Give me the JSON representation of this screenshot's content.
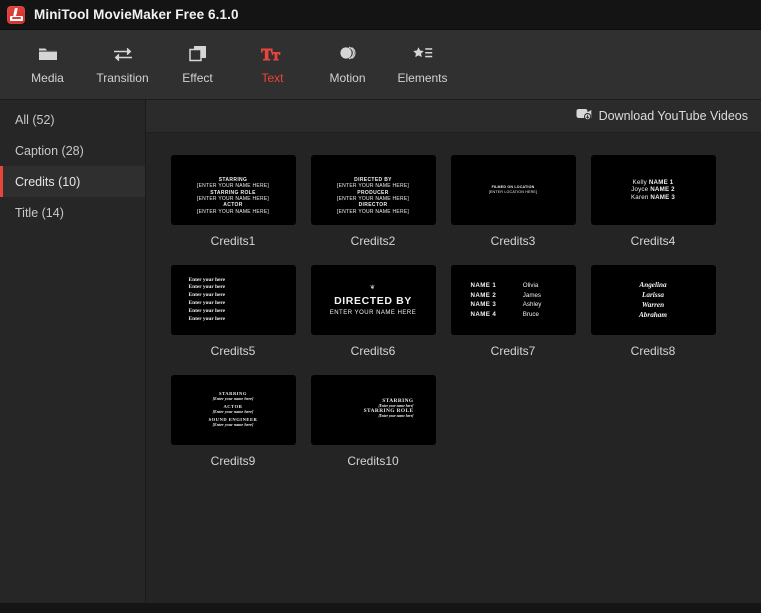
{
  "window": {
    "title": "MiniTool MovieMaker Free 6.1.0",
    "icon": "app-logo-icon"
  },
  "toolbar": {
    "items": [
      {
        "label": "Media",
        "icon": "folder-icon",
        "active": false
      },
      {
        "label": "Transition",
        "icon": "transition-icon",
        "active": false
      },
      {
        "label": "Effect",
        "icon": "layers-icon",
        "active": false
      },
      {
        "label": "Text",
        "icon": "text-icon",
        "active": true
      },
      {
        "label": "Motion",
        "icon": "motion-icon",
        "active": false
      },
      {
        "label": "Elements",
        "icon": "elements-icon",
        "active": false
      }
    ],
    "accent_color": "#e8453c"
  },
  "sidebar": {
    "items": [
      {
        "label": "All (52)",
        "active": false
      },
      {
        "label": "Caption (28)",
        "active": false
      },
      {
        "label": "Credits (10)",
        "active": true
      },
      {
        "label": "Title (14)",
        "active": false
      }
    ]
  },
  "content_header": {
    "download_label": "Download YouTube Videos",
    "download_icon": "youtube-download-icon"
  },
  "templates": [
    {
      "name": "Credits1",
      "preview_lines": [
        "STARRING",
        "[ENTER YOUR NAME HERE]",
        "STARRING ROLE",
        "[ENTER YOUR NAME HERE]",
        "ACTOR",
        "[ENTER YOUR NAME HERE]"
      ]
    },
    {
      "name": "Credits2",
      "preview_lines": [
        "DIRECTED BY",
        "[ENTER YOUR NAME HERE]",
        "PRODUCER",
        "[ENTER YOUR NAME HERE]",
        "DIRECTOR",
        "[ENTER YOUR NAME HERE]"
      ]
    },
    {
      "name": "Credits3",
      "preview_lines": [
        "FILMED ON LOCATION",
        "[ENTER LOCATION HERE]"
      ]
    },
    {
      "name": "Credits4",
      "preview_rows": [
        {
          "first": "Kelly",
          "second": "NAME 1"
        },
        {
          "first": "Joyce",
          "second": "NAME 2"
        },
        {
          "first": "Karen",
          "second": "NAME 3"
        }
      ]
    },
    {
      "name": "Credits5",
      "preview_lines": [
        "Enter your here",
        "Enter your here",
        "Enter your here",
        "Enter your here",
        "Enter your here",
        "Enter your here"
      ]
    },
    {
      "name": "Credits6",
      "ornament": "❦",
      "heading": "DIRECTED BY",
      "subheading": "ENTER YOUR NAME HERE"
    },
    {
      "name": "Credits7",
      "preview_rows": [
        {
          "first": "NAME 1",
          "second": "Olivia"
        },
        {
          "first": "NAME 2",
          "second": "James"
        },
        {
          "first": "NAME 3",
          "second": "Ashley"
        },
        {
          "first": "NAME 4",
          "second": "Bruce"
        }
      ]
    },
    {
      "name": "Credits8",
      "preview_lines": [
        "Angelina",
        "Larissa",
        "Warren",
        "Abraham"
      ]
    },
    {
      "name": "Credits9",
      "preview_lines": [
        "STARRING",
        "[Enter your name here]",
        "ACTOR",
        "[Enter your name here]",
        "SOUND ENGINEER",
        "[Enter your name here]"
      ]
    },
    {
      "name": "Credits10",
      "preview_lines": [
        "STARRING",
        "[Enter your name here]",
        "STARRING ROLE",
        "[Enter your name here]"
      ]
    }
  ]
}
